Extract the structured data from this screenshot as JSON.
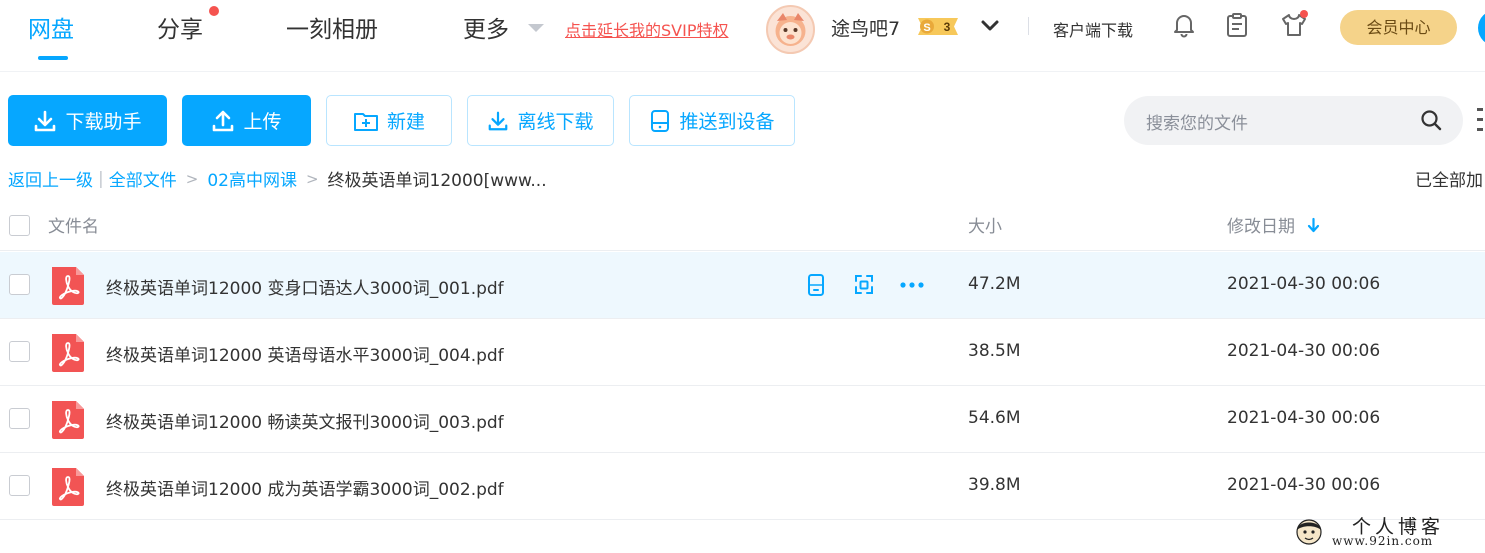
{
  "nav": {
    "items": [
      {
        "label": "网盘",
        "active": true
      },
      {
        "label": "分享",
        "has_dot": true
      },
      {
        "label": "一刻相册"
      },
      {
        "label": "更多"
      }
    ],
    "promo": "点击延长我的SVIP特权",
    "username": "途鸟吧7",
    "vip_level": "3",
    "client_download": "客户端下载",
    "vip_center": "会员中心",
    "icons": [
      "bell-icon",
      "clipboard-icon",
      "tshirt-icon"
    ]
  },
  "toolbar": {
    "download_helper": "下载助手",
    "upload": "上传",
    "new": "新建",
    "offline_download": "离线下载",
    "push_to_device": "推送到设备",
    "search_placeholder": "搜索您的文件"
  },
  "breadcrumb": {
    "back": "返回上一级",
    "sep": "|",
    "items": [
      "全部文件",
      "02高中网课"
    ],
    "current": "终极英语单词12000[www...",
    "loaded_all": "已全部加"
  },
  "table": {
    "headers": {
      "name": "文件名",
      "size": "大小",
      "date": "修改日期"
    },
    "rows": [
      {
        "name": "终极英语单词12000 变身口语达人3000词_001.pdf",
        "size": "47.2M",
        "date": "2021-04-30 00:06",
        "hover": true
      },
      {
        "name": "终极英语单词12000 英语母语水平3000词_004.pdf",
        "size": "38.5M",
        "date": "2021-04-30 00:06"
      },
      {
        "name": "终极英语单词12000 畅读英文报刊3000词_003.pdf",
        "size": "54.6M",
        "date": "2021-04-30 00:06"
      },
      {
        "name": "终极英语单词12000 成为英语学霸3000词_002.pdf",
        "size": "39.8M",
        "date": "2021-04-30 00:06"
      }
    ]
  },
  "watermark": {
    "line1": "个人博客",
    "line2": "www.92in.com"
  },
  "colors": {
    "accent": "#06a7ff",
    "danger": "#f5534f",
    "vip_gold": "#f5d38a",
    "pdf_red": "#f25454"
  }
}
